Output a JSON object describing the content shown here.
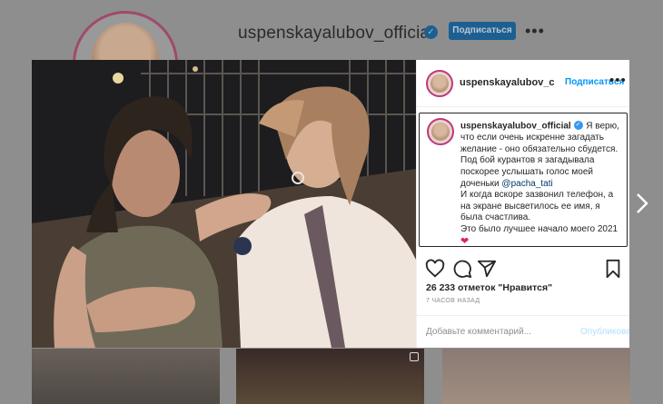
{
  "profile": {
    "username": "uspenskayalubov_official",
    "subscribe_label": "Подписаться",
    "more_label": "•••"
  },
  "post": {
    "header": {
      "username": "uspenskayalubov_c",
      "follow_label": "Подписаться",
      "more_label": "•••"
    },
    "caption": {
      "username": "uspenskayalubov_official",
      "line1": "Я верю, что если очень искренне загадать желание - оно обязательно сбудется.",
      "line2_before": "Под бой курантов я загадывала поскорее услышать голос моей доченьки ",
      "mention": "@pacha_tati",
      "line3": "И когда вскоре зазвонил телефон, а на экране высветилось ее имя, я была счастлива.",
      "line4": "Это было лучшее начало моего 2021"
    },
    "likes_text": "26 233 отметок \"Нравится\"",
    "time_ago": "7 ЧАСОВ НАЗАД",
    "comment_placeholder": "Добавьте комментарий...",
    "publish_label": "Опубликовать"
  },
  "colors": {
    "accent": "#0095f6",
    "publish_disabled": "#b2dffc",
    "overlay": "#8e8e8e"
  },
  "icons": [
    "heart-icon",
    "comment-icon",
    "share-icon",
    "bookmark-icon",
    "chevron-right-icon",
    "verified-icon"
  ]
}
